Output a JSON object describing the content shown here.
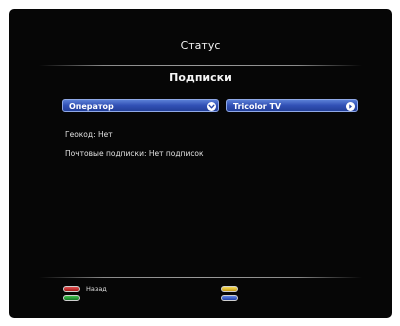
{
  "header": {
    "title": "Статус",
    "subtitle": "Подписки"
  },
  "operator_field": {
    "label": "Оператор",
    "value": "Tricolor TV"
  },
  "info": {
    "geocode": "Геокод: Нет",
    "mail_subscriptions": "Почтовые подписки: Нет подписок"
  },
  "footer": {
    "red_key_label": "Назад"
  },
  "colors": {
    "field_blue": "#3150b5",
    "red_key": "#c02424",
    "green_key": "#1f8f32",
    "yellow_key": "#e0b52a",
    "blue_key": "#3a5fd0"
  }
}
